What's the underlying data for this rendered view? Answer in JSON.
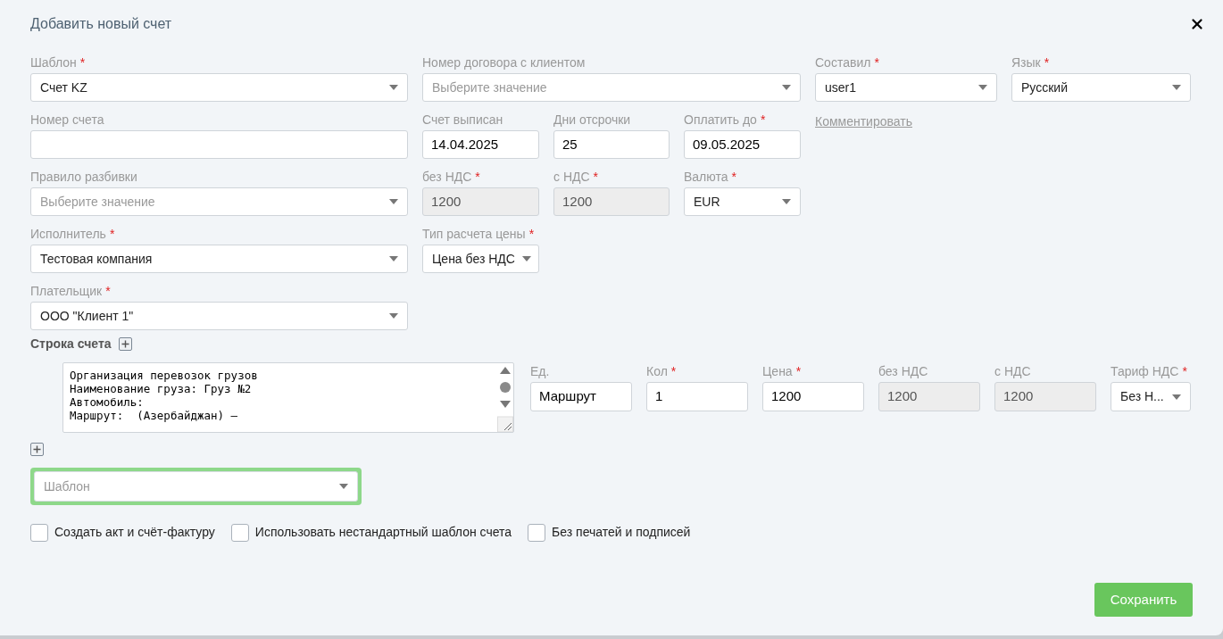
{
  "dialog": {
    "title": "Добавить новый счет"
  },
  "rows": [
    [
      {
        "kind": "select",
        "label": "Шаблон",
        "mark": "*",
        "value": "Счет KZ"
      },
      {
        "kind": "select",
        "label": "Номер договора с клиентом",
        "placeholder": "Выберите значение"
      },
      {
        "kind": "select",
        "label": "Составил",
        "mark": "*",
        "value": "user1"
      },
      {
        "kind": "select",
        "label": "Язык",
        "mark": "*",
        "value": "Русский"
      }
    ],
    [
      {
        "kind": "input",
        "label": "Номер счета"
      },
      {
        "kind": "input",
        "label": "Счет выписан",
        "value": "14.04.2025"
      },
      {
        "kind": "input",
        "label": "Дни отсрочки",
        "value": "25"
      },
      {
        "kind": "input",
        "label": "Оплатить до",
        "mark": "*",
        "value": "09.05.2025"
      },
      {
        "kind": "link",
        "label": "Комментировать"
      }
    ],
    [
      {
        "kind": "select",
        "label": "Правило разбивки",
        "placeholder": "Выберите значение"
      },
      {
        "kind": "input",
        "label": "без НДС",
        "mark": "*",
        "value": "1200",
        "disabled": true
      },
      {
        "kind": "input",
        "label": "с НДС",
        "mark": "*",
        "value": "1200",
        "disabled": true
      },
      {
        "kind": "select",
        "label": "Валюта",
        "mark": "*",
        "value": "EUR"
      }
    ],
    [
      {
        "kind": "select",
        "label": "Исполнитель",
        "mark": "*",
        "value": "Тестовая компания"
      },
      {
        "kind": "select",
        "label": "Тип расчета цены",
        "mark": "*",
        "value": "Цена без НДС"
      }
    ],
    [
      {
        "kind": "select",
        "label": "Плательщик",
        "mark": "*",
        "value": "ООО \"Клиент 1\""
      }
    ]
  ],
  "line_section": {
    "title": "Строка счета"
  },
  "line_item": {
    "description": [
      "Организация перевозок грузов",
      "Наименование груза: Груз №2",
      "Автомобиль:",
      "Маршрут:  (Азербайджан) –"
    ],
    "fields": [
      {
        "kind": "input",
        "label": "Ед.",
        "value": "Маршрут"
      },
      {
        "kind": "input",
        "label": "Кол",
        "mark": "*",
        "value": "1"
      },
      {
        "kind": "input",
        "label": "Цена",
        "mark": "*",
        "value": "1200"
      },
      {
        "kind": "input",
        "label": "без НДС",
        "value": "1200",
        "disabled": true
      },
      {
        "kind": "input",
        "label": "с НДС",
        "value": "1200",
        "disabled": true
      },
      {
        "kind": "select",
        "label": "Тариф НДС",
        "mark": "*",
        "value": "Без Н..."
      }
    ]
  },
  "template_select": {
    "placeholder": "Шаблон",
    "focused": true
  },
  "checkboxes": [
    {
      "label": "Создать акт и счёт-фактуру",
      "checked": false
    },
    {
      "label": "Использовать нестандартный шаблон счета",
      "checked": false
    },
    {
      "label": "Без печатей и подписей",
      "checked": false
    }
  ],
  "save_button": "Сохранить"
}
